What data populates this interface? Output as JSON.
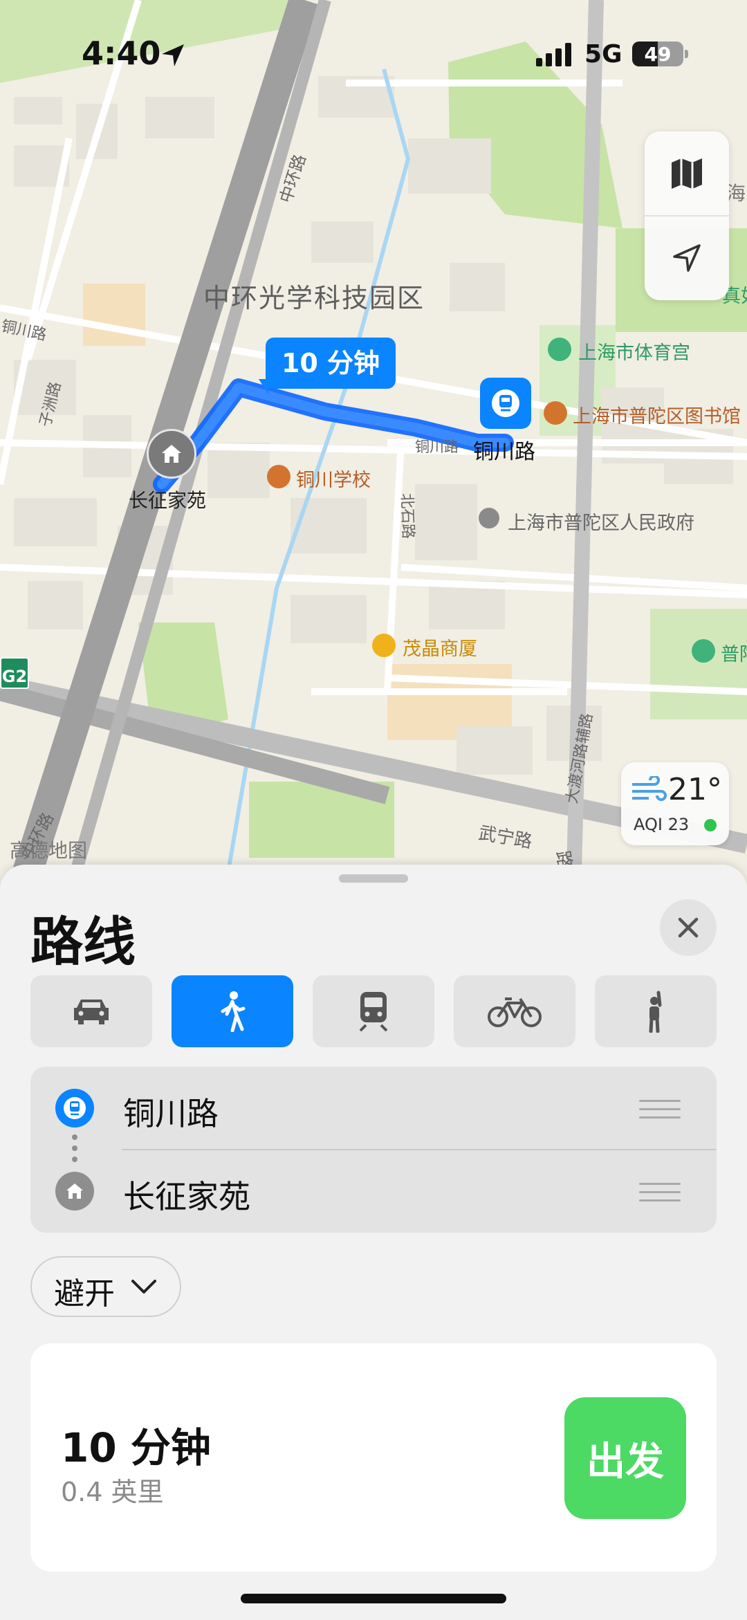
{
  "status_bar": {
    "time": "4:40",
    "network": "5G",
    "battery": "49"
  },
  "map": {
    "route_duration": "10 分钟",
    "district_label": "中环光学科技园区",
    "road_labels": {
      "zhonghuan_top": "中环路",
      "tongchuan_left": "铜川路",
      "zishui": "子洲路",
      "tongchuan_small": "铜川路",
      "beishi": "北石路",
      "wuning": "武宁路",
      "daduhe": "大渡河路辅路",
      "zhonghuan_bottom": "中环路",
      "road_cut": "路"
    },
    "pois": {
      "start_station": "铜川路",
      "end_home": "长征家苑",
      "school": "铜川学校",
      "gym": "上海市体育宫",
      "library": "上海市普陀区图书馆",
      "gov": "上海市普陀区人民政府",
      "mall": "茂晶商厦",
      "park_cut": "普陀",
      "top_right_cut": "海",
      "right_cut": "真如",
      "highway": "G2"
    },
    "watermark": "高德地图",
    "weather": {
      "temp": "21°",
      "aqi": "AQI 23"
    }
  },
  "sheet": {
    "title": "路线",
    "modes": [
      {
        "name": "drive",
        "icon": "car-icon"
      },
      {
        "name": "walk",
        "icon": "walk-icon"
      },
      {
        "name": "transit",
        "icon": "train-icon"
      },
      {
        "name": "cycle",
        "icon": "bicycle-icon"
      },
      {
        "name": "rideshare",
        "icon": "hail-icon"
      }
    ],
    "active_mode": "walk",
    "waypoints": [
      {
        "label": "铜川路",
        "icon": "train-station-icon"
      },
      {
        "label": "长征家苑",
        "icon": "home-icon"
      }
    ],
    "avoid_label": "避开",
    "route": {
      "duration": "10 分钟",
      "distance": "0.4 英里",
      "go_label": "出发"
    }
  },
  "colors": {
    "accent": "#0a84ff",
    "go": "#4cd964"
  }
}
